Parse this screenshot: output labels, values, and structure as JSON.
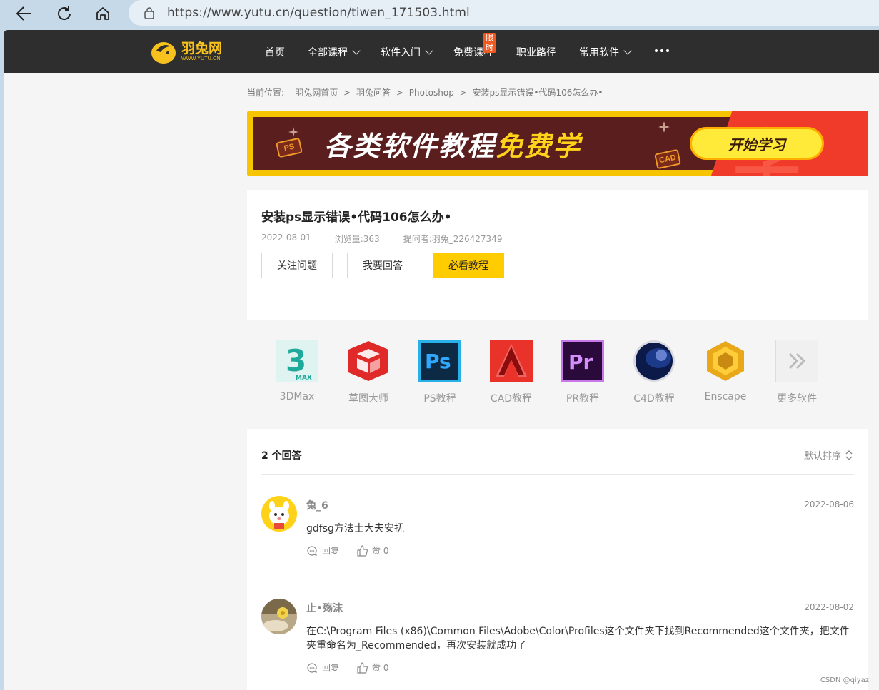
{
  "browser": {
    "url": "https://www.yutu.cn/question/tiwen_171503.html"
  },
  "header": {
    "logo_cn": "羽兔网",
    "logo_en": "WWW.YUTU.CN",
    "menu": [
      {
        "label": "首页"
      },
      {
        "label": "全部课程"
      },
      {
        "label": "软件入门"
      },
      {
        "label": "免费课程"
      },
      {
        "label": "职业路径"
      },
      {
        "label": "常用软件"
      }
    ],
    "limit_badge": "限时"
  },
  "breadcrumb": {
    "prefix": "当前位置:",
    "items": [
      "羽兔网首页",
      "羽兔问答",
      "Photoshop",
      "安装ps显示错误•代码106怎么办•"
    ],
    "separator": ">"
  },
  "banner": {
    "title_main": "各类软件教程",
    "title_highlight": "免费学",
    "button": "开始学习",
    "tag_ps": "PS",
    "tag_cad": "CAD",
    "bg_char": "学"
  },
  "question": {
    "title": "安装ps显示错误•代码106怎么办•",
    "date": "2022-08-01",
    "views": "浏览量:363",
    "asker": "提问者:羽兔_226427349",
    "btn_follow": "关注问题",
    "btn_answer": "我要回答",
    "btn_tutorial": "必看教程"
  },
  "software": [
    {
      "label": "3DMax",
      "icon": "3dsmax-icon"
    },
    {
      "label": "草图大师",
      "icon": "sketchup-icon"
    },
    {
      "label": "PS教程",
      "icon": "photoshop-icon"
    },
    {
      "label": "CAD教程",
      "icon": "autocad-icon"
    },
    {
      "label": "PR教程",
      "icon": "premiere-icon"
    },
    {
      "label": "C4D教程",
      "icon": "cinema4d-icon"
    },
    {
      "label": "Enscape",
      "icon": "enscape-icon"
    },
    {
      "label": "更多软件",
      "icon": "more-icon"
    }
  ],
  "answers": {
    "count_label": "2 个回答",
    "sort_label": "默认排序",
    "items": [
      {
        "user": "兔_6",
        "date": "2022-08-06",
        "body": "gdfsg方法士大夫安抚",
        "reply": "回复",
        "like": "赞 0"
      },
      {
        "user": "止•殇沫",
        "date": "2022-08-02",
        "body": "在C:\\Program Files (x86)\\Common Files\\Adobe\\Color\\Profiles这个文件夹下找到Recommended这个文件夹，把文件夹重命名为_Recommended，再次安装就成功了",
        "reply": "回复",
        "like": "赞 0"
      }
    ]
  },
  "watermark": "CSDN @qiyaz",
  "colors": {
    "header_bg": "#2e2e2e",
    "accent": "#ffcc00",
    "logo": "#f7c21d",
    "badge": "#f05a22"
  }
}
